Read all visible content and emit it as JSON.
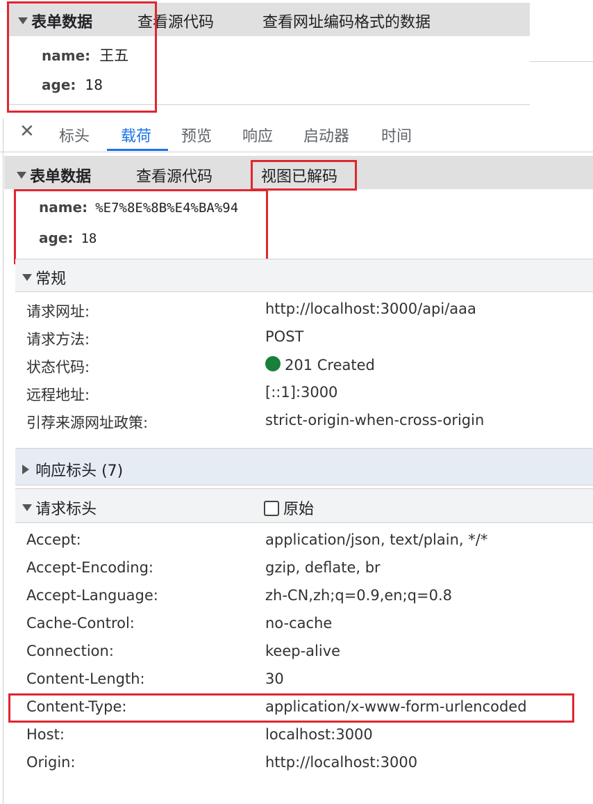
{
  "top_panel": {
    "header": {
      "title": "表单数据",
      "view_source": "查看源代码",
      "view_url_encoded": "查看网址编码格式的数据"
    },
    "fields": [
      {
        "key": "name:",
        "value": "王五"
      },
      {
        "key": "age:",
        "value": "18"
      }
    ]
  },
  "tabs": {
    "close_symbol": "✕",
    "items": [
      "标头",
      "载荷",
      "预览",
      "响应",
      "启动器",
      "时间"
    ],
    "active": "载荷"
  },
  "payload_panel": {
    "header": {
      "title": "表单数据",
      "view_source": "查看源代码",
      "view_decoded": "视图已解码"
    },
    "fields": [
      {
        "key": "name:",
        "value": "%E7%8E%8B%E4%BA%94"
      },
      {
        "key": "age:",
        "value": "18"
      }
    ]
  },
  "general": {
    "title": "常规",
    "rows": [
      {
        "key": "请求网址:",
        "value": "http://localhost:3000/api/aaa"
      },
      {
        "key": "请求方法:",
        "value": "POST"
      },
      {
        "key": "状态代码:",
        "value": "201 Created"
      },
      {
        "key": "远程地址:",
        "value": "[::1]:3000"
      },
      {
        "key": "引荐来源网址政策:",
        "value": "strict-origin-when-cross-origin"
      }
    ],
    "status_color": "#188038"
  },
  "response_headers": {
    "title": "响应标头 (7)"
  },
  "request_headers": {
    "title": "请求标头",
    "raw_label": "原始",
    "rows": [
      {
        "key": "Accept:",
        "value": "application/json, text/plain, */*"
      },
      {
        "key": "Accept-Encoding:",
        "value": "gzip, deflate, br"
      },
      {
        "key": "Accept-Language:",
        "value": "zh-CN,zh;q=0.9,en;q=0.8"
      },
      {
        "key": "Cache-Control:",
        "value": "no-cache"
      },
      {
        "key": "Connection:",
        "value": "keep-alive"
      },
      {
        "key": "Content-Length:",
        "value": "30"
      },
      {
        "key": "Content-Type:",
        "value": "application/x-www-form-urlencoded"
      },
      {
        "key": "Host:",
        "value": "localhost:3000"
      },
      {
        "key": "Origin:",
        "value": "http://localhost:3000"
      }
    ]
  },
  "colors": {
    "highlight_box": "#e0262f",
    "active_tab": "#1a73e8"
  }
}
